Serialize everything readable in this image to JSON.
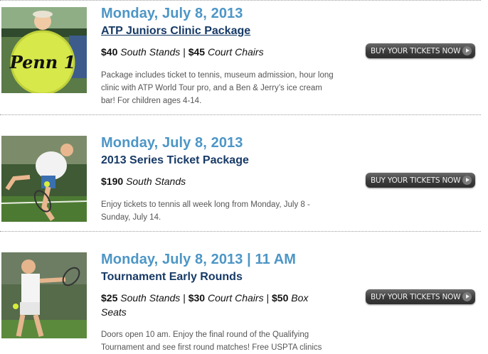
{
  "events": [
    {
      "date": "Monday, July 8, 2013",
      "title": "ATP Juniors Clinic Package",
      "price_parts": [
        {
          "amount": "$40",
          "section": "South Stands"
        },
        {
          "amount": "$45",
          "section": "Court Chairs"
        }
      ],
      "description": "Package includes ticket to tennis, museum admission, hour long clinic with ATP World Tour pro, and a Ben & Jerry’s ice cream bar! For children ages 4-14.",
      "button_label": "BUY YOUR TICKETS NOW",
      "image_text": "Penn 1"
    },
    {
      "date": "Monday, July 8, 2013",
      "title": "2013 Series Ticket Package",
      "price_parts": [
        {
          "amount": "$190",
          "section": "South Stands"
        }
      ],
      "description": "Enjoy tickets to tennis all week long from Monday, July 8 - Sunday, July 14.",
      "button_label": "BUY YOUR TICKETS NOW"
    },
    {
      "date": "Monday, July 8, 2013 | 11 AM",
      "title": "Tournament Early Rounds",
      "price_parts": [
        {
          "amount": "$25",
          "section": "South Stands"
        },
        {
          "amount": "$30",
          "section": "Court Chairs"
        },
        {
          "amount": "$50",
          "section": "Box Seats"
        }
      ],
      "description": "Doors open 10 am.  Enjoy the final round of the Qualifying Tournament and see first round matches!  Free USPTA clinics",
      "button_label": "BUY YOUR TICKETS NOW"
    }
  ],
  "colors": {
    "date": "#4d96c6",
    "title": "#173a66",
    "button": "#3c3c3c"
  }
}
